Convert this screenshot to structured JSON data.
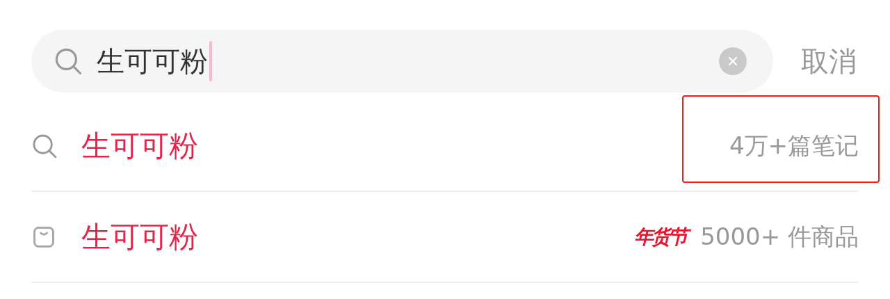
{
  "search": {
    "value": "生可可粉",
    "cancel": "取消"
  },
  "rows": [
    {
      "kind": "note",
      "term": "生可可粉",
      "count": "4万+篇笔记",
      "highlighted": true
    },
    {
      "kind": "product",
      "term": "生可可粉",
      "badge": "年货节",
      "count": "5000+ 件商品",
      "highlighted": false
    }
  ]
}
